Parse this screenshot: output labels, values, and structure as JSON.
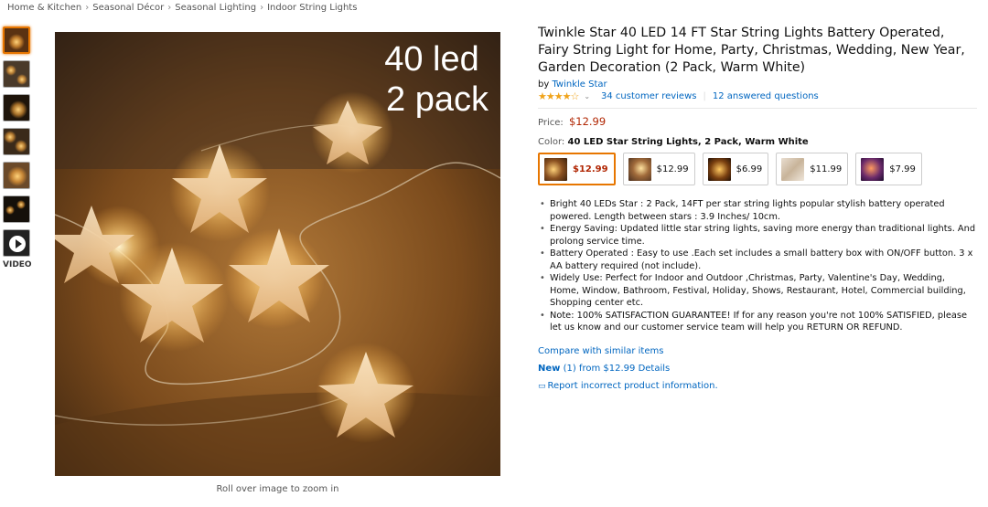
{
  "breadcrumb": [
    "Home & Kitchen",
    "Seasonal Décor",
    "Seasonal Lighting",
    "Indoor String Lights"
  ],
  "thumbnails": {
    "video_label": "VIDEO"
  },
  "main_image": {
    "overlay_line1": "40 led",
    "overlay_line2": "2 pack",
    "caption": "Roll over image to zoom in"
  },
  "product": {
    "title": "Twinkle Star 40 LED 14 FT Star String Lights Battery Operated, Fairy String Light for Home, Party, Christmas, Wedding, New Year, Garden Decoration (2 Pack, Warm White)",
    "by_label": "by",
    "brand": "Twinkle Star",
    "rating_stars": "★★★★☆",
    "reviews_link": "34 customer reviews",
    "questions_link": "12 answered questions",
    "price_label": "Price:",
    "price": "$12.99",
    "color_label": "Color:",
    "color_value": "40 LED Star String Lights, 2 Pack, Warm White"
  },
  "swatches": [
    {
      "price": "$12.99"
    },
    {
      "price": "$12.99"
    },
    {
      "price": "$6.99"
    },
    {
      "price": "$11.99"
    },
    {
      "price": "$7.99"
    }
  ],
  "bullets": [
    "Bright 40 LEDs Star : 2 Pack, 14FT per star string lights popular stylish battery operated powered. Length between stars : 3.9 Inches/ 10cm.",
    "Energy Saving: Updated little star string lights, saving more energy than traditional lights. And prolong service time.",
    "Battery Operated : Easy to use .Each set includes a small battery box with ON/OFF button. 3 x AA battery required (not include).",
    "Widely Use: Perfect for Indoor and Outdoor ,Christmas, Party, Valentine's Day, Wedding, Home, Window, Bathroom, Festival, Holiday, Shows, Restaurant, Hotel, Commercial building, Shopping center etc.",
    "Note: 100% SATISFACTION GUARANTEE! If for any reason you're not 100% SATISFIED, please let us know and our customer service team will help you RETURN OR REFUND."
  ],
  "links": {
    "compare": "Compare with similar items",
    "new_label": "New",
    "new_rest": "(1) from $12.99",
    "details": "Details",
    "report": "Report incorrect product information."
  },
  "colors": {
    "link": "#0066c0",
    "price": "#b12704",
    "selected_border": "#e77600",
    "star": "#f0a31a"
  }
}
